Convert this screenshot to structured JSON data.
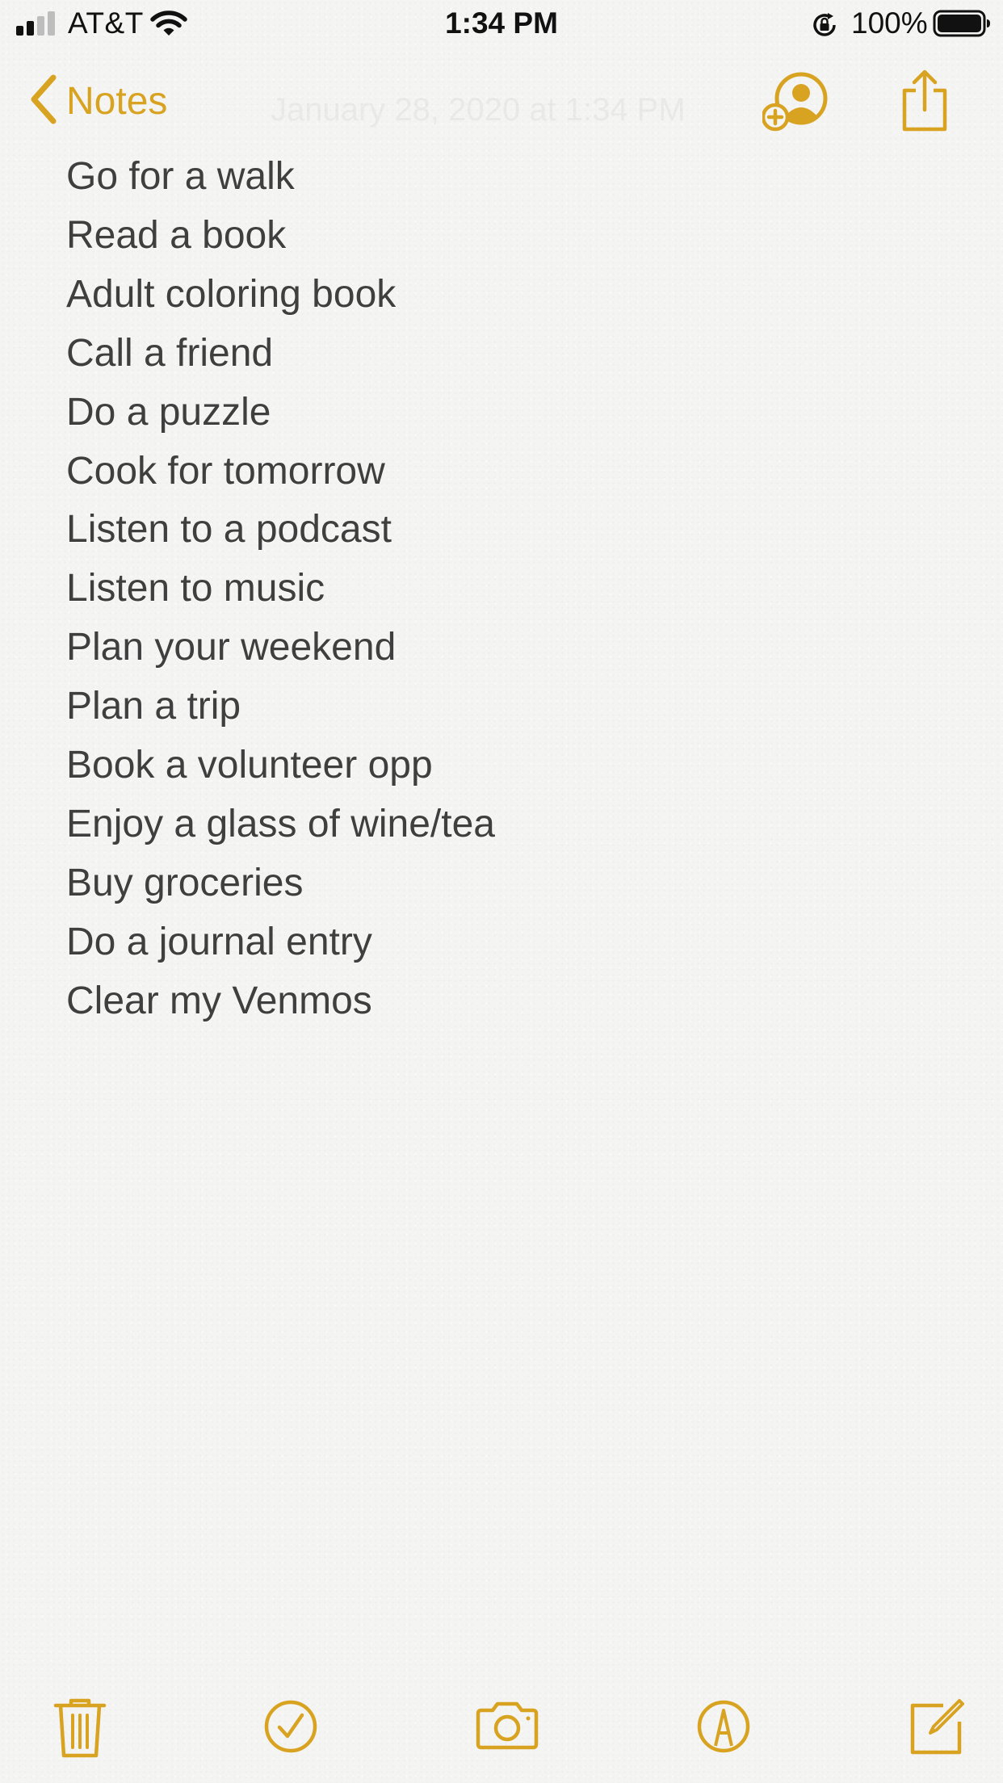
{
  "status_bar": {
    "carrier": "AT&T",
    "time": "1:34 PM",
    "battery_percent": "100%",
    "signal_bars_filled": 2,
    "signal_bars_total": 4
  },
  "nav": {
    "back_label": "Notes",
    "date_text": "January 28, 2020 at 1:34 PM"
  },
  "note": {
    "lines": [
      "Go for a walk",
      "Read a book",
      "Adult coloring book",
      "Call a friend",
      "Do a puzzle",
      "Cook for tomorrow",
      "Listen to a podcast",
      "Listen to music",
      "Plan your weekend",
      "Plan a trip",
      "Book a volunteer opp",
      "Enjoy a glass of wine/tea",
      "Buy groceries",
      "Do a journal entry",
      "Clear my Venmos"
    ]
  },
  "toolbar": {
    "icons": [
      "trash-icon",
      "checklist-icon",
      "camera-icon",
      "markup-icon",
      "compose-icon"
    ]
  },
  "colors": {
    "accent": "#d9a322",
    "text": "#3f3f3f",
    "background": "#f4f4f3"
  }
}
